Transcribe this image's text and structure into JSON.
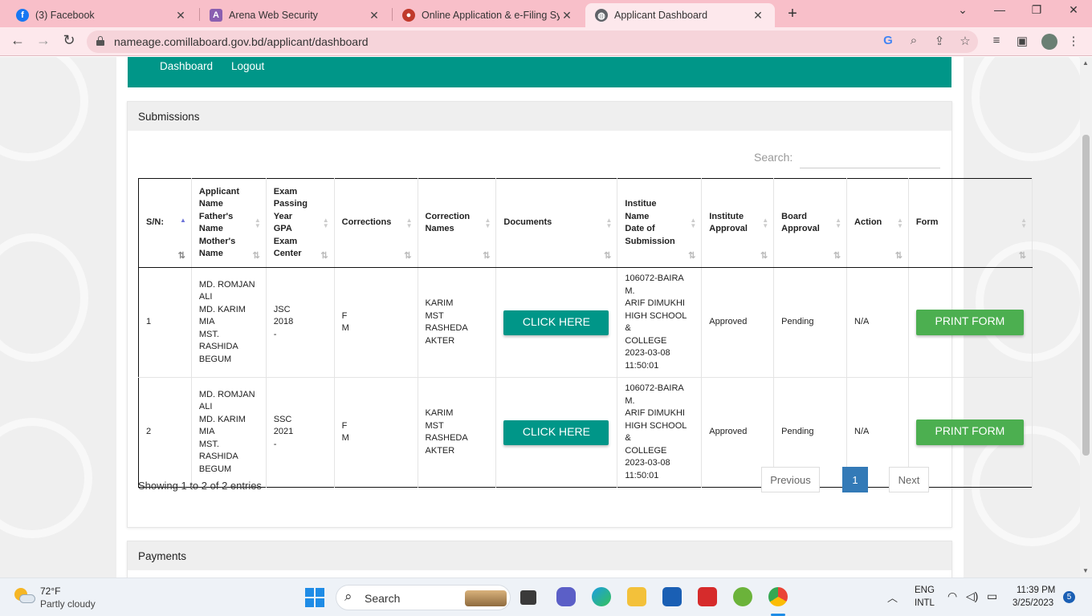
{
  "browser": {
    "tabs": [
      {
        "title": "(3) Facebook",
        "icon": "facebook-icon",
        "color": "#1877f2"
      },
      {
        "title": "Arena Web Security",
        "icon": "arena-icon",
        "color": "#8a5fb0"
      },
      {
        "title": "Online Application & e-Filing Sys",
        "icon": "board-logo-icon",
        "color": "#c0392b"
      },
      {
        "title": "Applicant Dashboard",
        "icon": "globe-icon",
        "color": "#5f6368"
      }
    ],
    "url": "nameage.comillaboard.gov.bd/applicant/dashboard"
  },
  "nav": {
    "dashboard": "Dashboard",
    "logout": "Logout",
    "color": "#009688"
  },
  "submissions": {
    "title": "Submissions",
    "search_label": "Search:",
    "search_value": "",
    "headers": {
      "sn": "S/N:",
      "applicant": "Applicant\nName\nFather's\nName\nMother's\nName",
      "exam": "Exam\nPassing\nYear\nGPA\nExam\nCenter",
      "corrections": "Corrections",
      "correction_names": "Correction\nNames",
      "documents": "Documents",
      "institute": "Institue\nName\nDate of\nSubmission",
      "inst_approval": "Institute\nApproval",
      "board_approval": "Board\nApproval",
      "action": "Action",
      "form": "Form"
    },
    "rows": [
      {
        "sn": "1",
        "applicant": "MD. ROMJAN\nALI\nMD. KARIM\nMIA\nMST.\nRASHIDA\nBEGUM",
        "exam": "JSC\n2018\n-",
        "corrections": "F\nM",
        "correction_names": "KARIM\nMST RASHEDA\nAKTER",
        "documents_btn": "CLICK HERE",
        "institute": "106072-BAIRA M.\nARIF DIMUKHI\nHIGH SCHOOL &\nCOLLEGE\n2023-03-08\n11:50:01",
        "inst_approval": "Approved",
        "board_approval": "Pending",
        "action": "N/A",
        "form_btn": "PRINT FORM"
      },
      {
        "sn": "2",
        "applicant": "MD. ROMJAN\nALI\nMD. KARIM\nMIA\nMST.\nRASHIDA\nBEGUM",
        "exam": "SSC\n2021\n-",
        "corrections": "F\nM",
        "correction_names": "KARIM\nMST RASHEDA\nAKTER",
        "documents_btn": "CLICK HERE",
        "institute": "106072-BAIRA M.\nARIF DIMUKHI\nHIGH SCHOOL &\nCOLLEGE\n2023-03-08\n11:50:01",
        "inst_approval": "Approved",
        "board_approval": "Pending",
        "action": "N/A",
        "form_btn": "PRINT FORM"
      }
    ],
    "info": "Showing 1 to 2 of 2 entries",
    "pagination": {
      "previous": "Previous",
      "current": "1",
      "next": "Next"
    }
  },
  "payments": {
    "title": "Payments"
  },
  "taskbar": {
    "weather_temp": "72°F",
    "weather_desc": "Partly cloudy",
    "search_placeholder": "Search",
    "lang": "ENG",
    "lang2": "INTL",
    "time": "11:39 PM",
    "date": "3/25/2023",
    "notif_count": "5"
  }
}
